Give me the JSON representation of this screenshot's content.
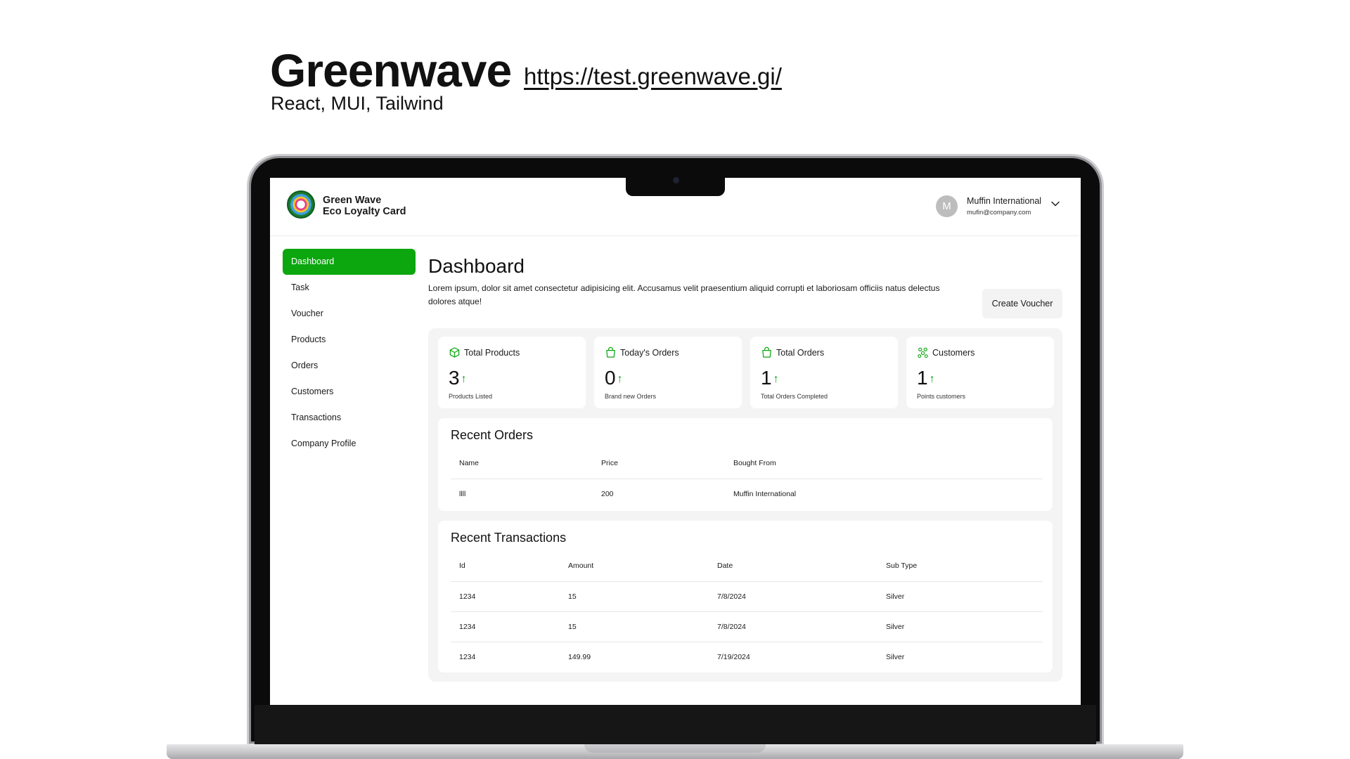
{
  "hero": {
    "title": "Greenwave",
    "url": "https://test.greenwave.gi/",
    "subtitle": "React, MUI, Tailwind"
  },
  "app": {
    "brand_line1": "Green Wave",
    "brand_line2": "Eco Loyalty Card",
    "user": {
      "initial": "M",
      "name": "Muffin International",
      "email": "mufin@company.com"
    }
  },
  "sidebar": {
    "items": [
      {
        "label": "Dashboard",
        "active": true
      },
      {
        "label": "Task"
      },
      {
        "label": "Voucher"
      },
      {
        "label": "Products"
      },
      {
        "label": "Orders"
      },
      {
        "label": "Customers"
      },
      {
        "label": "Transactions"
      },
      {
        "label": "Company Profile"
      }
    ]
  },
  "page": {
    "title": "Dashboard",
    "description": "Lorem ipsum, dolor sit amet consectetur adipisicing elit. Accusamus velit praesentium aliquid corrupti et laboriosam officiis natus delectus dolores atque!",
    "create_button": "Create Voucher"
  },
  "stats": [
    {
      "label": "Total Products",
      "value": "3",
      "sub": "Products Listed",
      "icon": "box-icon"
    },
    {
      "label": "Today's Orders",
      "value": "0",
      "sub": "Brand new Orders",
      "icon": "bag-icon"
    },
    {
      "label": "Total Orders",
      "value": "1",
      "sub": "Total Orders Completed",
      "icon": "bag-icon"
    },
    {
      "label": "Customers",
      "value": "1",
      "sub": "Points customers",
      "icon": "users-icon"
    }
  ],
  "recent_orders": {
    "title": "Recent Orders",
    "columns": [
      "Name",
      "Price",
      "Bought From"
    ],
    "rows": [
      [
        "llll",
        "200",
        "Muffin International"
      ]
    ]
  },
  "recent_transactions": {
    "title": "Recent Transactions",
    "columns": [
      "Id",
      "Amount",
      "Date",
      "Sub Type"
    ],
    "rows": [
      [
        "1234",
        "15",
        "7/8/2024",
        "Silver"
      ],
      [
        "1234",
        "15",
        "7/8/2024",
        "Silver"
      ],
      [
        "1234",
        "149.99",
        "7/19/2024",
        "Silver"
      ]
    ]
  },
  "colors": {
    "accent": "#0ca60f",
    "panel": "#f4f4f4"
  }
}
